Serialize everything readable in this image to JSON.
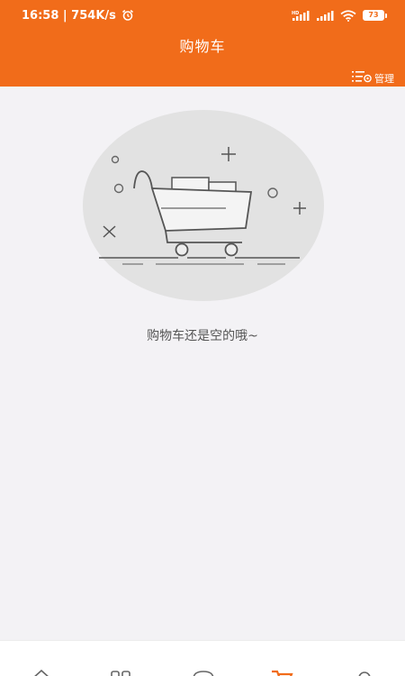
{
  "status_bar": {
    "time_speed": "16:58 | 754K/s",
    "battery": "73",
    "icons": [
      "alarm-icon",
      "hd-signal-icon",
      "signal-icon",
      "wifi-icon",
      "battery-icon"
    ]
  },
  "header": {
    "title": "购物车",
    "manage_label": "管理",
    "manage_icon": "manage-list-icon"
  },
  "empty_state": {
    "message": "购物车还是空的哦~",
    "illustration": "empty-cart-icon"
  },
  "tabbar": {
    "items": [
      {
        "icon": "home-icon"
      },
      {
        "icon": "category-icon"
      },
      {
        "icon": "message-icon"
      },
      {
        "icon": "cart-icon",
        "active": true
      },
      {
        "icon": "profile-icon"
      }
    ]
  },
  "colors": {
    "accent": "#f16c1a",
    "background": "#f3f2f5",
    "text_muted": "#555555"
  }
}
